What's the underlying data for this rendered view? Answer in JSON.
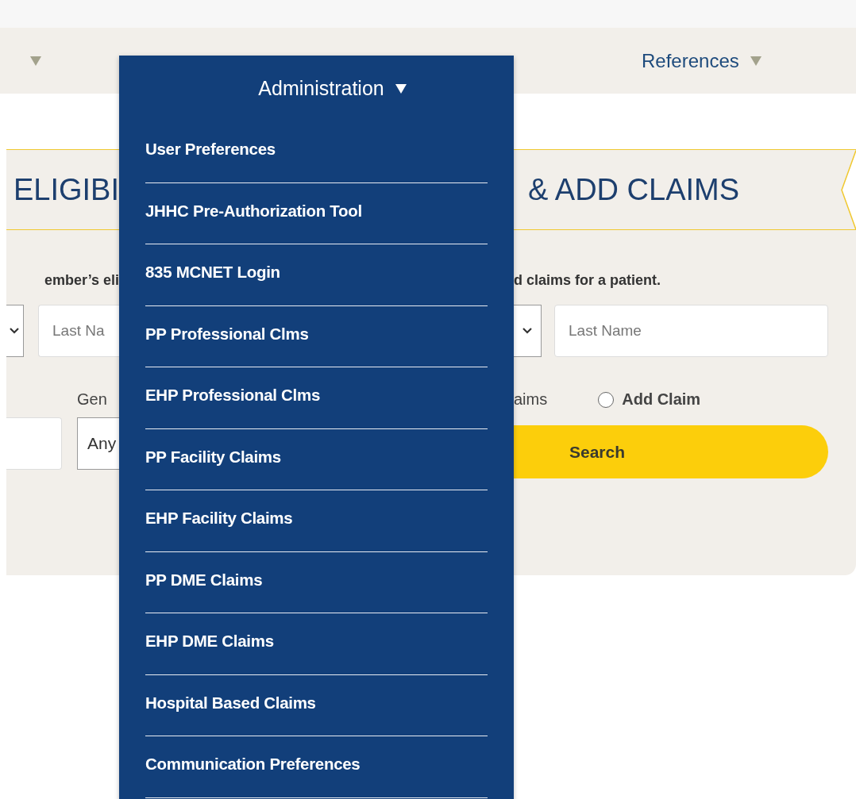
{
  "nav": {
    "admin_menu": {
      "label": "Administration",
      "expanded": true,
      "items": [
        {
          "label": "User Preferences"
        },
        {
          "label": "JHHC Pre-Authorization Tool"
        },
        {
          "label": "835 MCNET Login"
        },
        {
          "label": "PP Professional Clms"
        },
        {
          "label": "EHP Professional Clms"
        },
        {
          "label": "PP Facility Claims"
        },
        {
          "label": "EHP Facility Claims"
        },
        {
          "label": "PP DME Claims"
        },
        {
          "label": "EHP DME Claims"
        },
        {
          "label": "Hospital Based Claims"
        },
        {
          "label": "Communication Preferences"
        }
      ]
    },
    "references": {
      "label": "References"
    }
  },
  "banner": {
    "left_text": "ELIGIBI",
    "right_text": "& ADD CLAIMS"
  },
  "intro": {
    "left_text": "ember’s eli",
    "right_text": "d claims for a patient."
  },
  "form": {
    "last_name_left": {
      "placeholder": "Last Na"
    },
    "last_name_right": {
      "placeholder": "Last Name"
    },
    "gender_label": "Gen",
    "option_fragment": "aims",
    "add_claim": {
      "label": "Add Claim",
      "selected": false
    },
    "gender_select": {
      "value": "Any"
    },
    "search_button": "Search"
  }
}
